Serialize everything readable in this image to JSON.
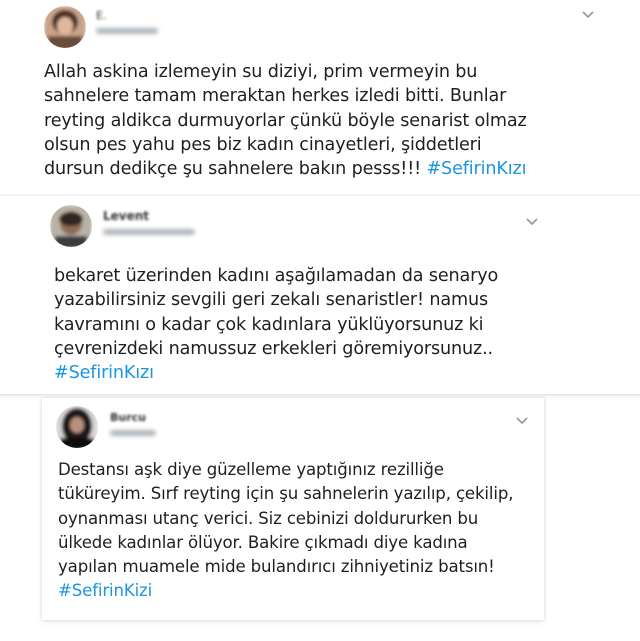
{
  "tweets": [
    {
      "user_initial": "E.",
      "text": "Allah askina izlemeyin su diziyi, prim vermeyin bu\nsahnelere tamam meraktan herkes izledi bitti. Bunlar\nreyting aldikca durmuyorlar çünkü böyle senarist olmaz\nolsun pes yahu pes biz kadın cinayetleri, şiddetleri\ndursun dedikçe şu sahnelere bakın pesss!!! ",
      "hashtag": "#SefirinKızı"
    },
    {
      "user_initial": "Levent",
      "text": "bekaret üzerinden kadını aşağılamadan da senaryo\nyazabilirsiniz sevgili geri zekalı senaristler! namus\nkavramını o kadar çok kadınlara yüklüyorsunuz ki\nçevrenizdeki namussuz erkekleri göremiyorsunuz..\n",
      "hashtag": "#SefirinKızı"
    },
    {
      "user_initial": "Burcu",
      "text": "Destansı aşk diye güzelleme yaptığınız rezilliğe\ntüküreyim. Sırf reyting için şu sahnelerin yazılıp, çekilip,\noynanması utanç verici. Siz cebinizi doldururken bu\nülkede kadınlar ölüyor. Bakire çıkmadı diye kadına\nyapılan muamele mide bulandırıcı zihniyetiniz batsın!\n",
      "hashtag": "#SefirinKizi"
    }
  ],
  "colors": {
    "hashtag": "#1b95e0",
    "text": "#1c2022",
    "caret": "#8a9aa8"
  },
  "icons": {
    "more": "chevron-down-icon"
  }
}
